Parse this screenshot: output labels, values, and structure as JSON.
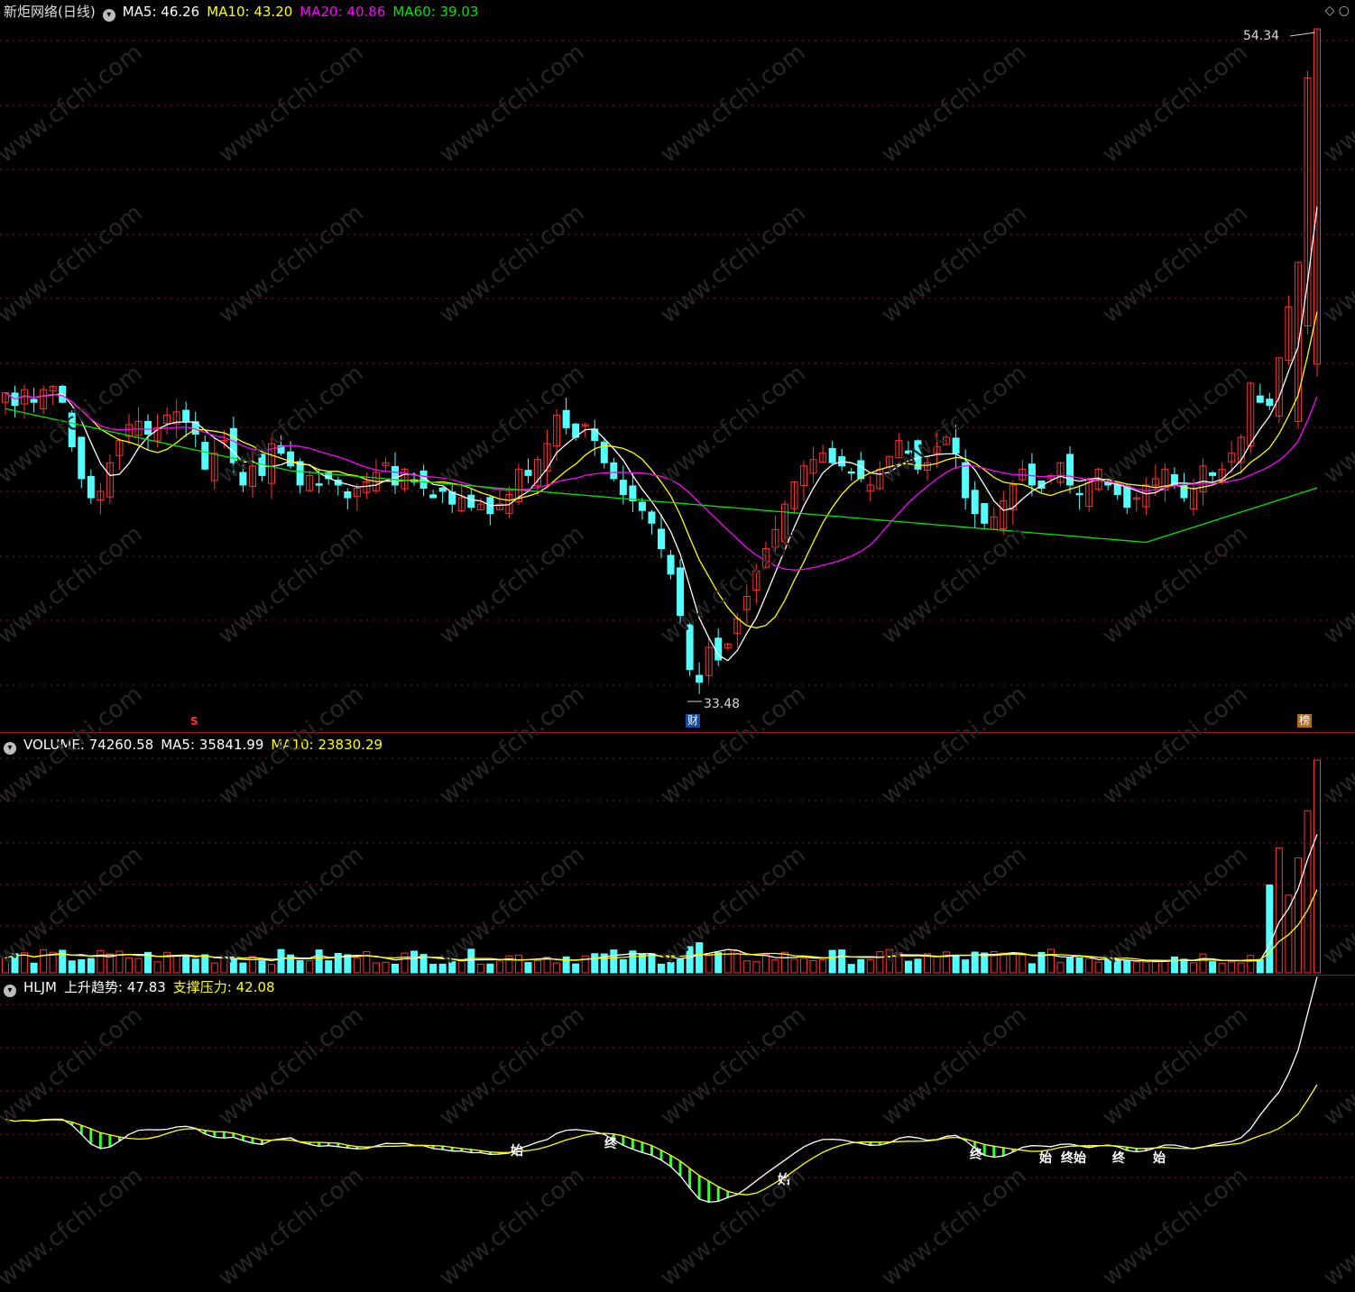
{
  "main": {
    "title": "新炬网络(日线)",
    "ma5": "MA5: 46.26",
    "ma10": "MA10: 43.20",
    "ma20": "MA20: 40.86",
    "ma60": "MA60: 39.03",
    "high_label": "54.34",
    "low_label": "33.48",
    "s_mark": "S",
    "cai_tag": "财",
    "bang_tag": "榜",
    "corner_icons": "◇ ○"
  },
  "volume": {
    "title": "VOLUME: 74260.58",
    "ma5": "MA5: 35841.99",
    "ma10": "MA10: 23830.29"
  },
  "indicator": {
    "title": "HLJM",
    "trend": "上升趋势: 47.83",
    "support": "支撑压力: 42.08",
    "markers": [
      "始",
      "终",
      "始",
      "终",
      "始",
      "终始",
      "终",
      "始"
    ]
  },
  "watermark": "www.cfchi.com",
  "colors": {
    "bg": "#000000",
    "up": "#ff3232",
    "down": "#54ffff",
    "ma5": "#ffffff",
    "ma10": "#ffff00",
    "ma20": "#ff00ff",
    "ma60": "#00e600",
    "grid": "#8b1a1a",
    "separator": "#a01818",
    "hist": "#33ff33"
  },
  "chart_data": {
    "type": "candlestick",
    "y_range_price": [
      33.48,
      54.34
    ],
    "closes": [
      42.9,
      42.5,
      43.0,
      42.6,
      43.0,
      43.1,
      42.6,
      41.2,
      40.2,
      39.6,
      39.8,
      40.7,
      41.4,
      41.9,
      42.0,
      41.6,
      41.8,
      42.2,
      42.3,
      42.0,
      41.6,
      40.5,
      41.0,
      41.4,
      40.7,
      40.0,
      40.6,
      40.3,
      41.3,
      41.0,
      40.6,
      40.0,
      40.3,
      40.0,
      40.2,
      40.0,
      39.6,
      39.9,
      40.1,
      40.4,
      40.7,
      40.0,
      40.5,
      40.1,
      39.9,
      39.6,
      39.8,
      39.4,
      39.6,
      39.3,
      39.4,
      39.1,
      39.4,
      39.7,
      40.5,
      40.3,
      40.8,
      41.3,
      42.2,
      41.8,
      41.5,
      41.9,
      41.4,
      40.7,
      40.2,
      39.7,
      39.5,
      39.2,
      38.8,
      38.0,
      37.2,
      35.9,
      34.2,
      33.8,
      34.9,
      34.5,
      35.0,
      35.8,
      36.5,
      37.3,
      38.0,
      38.6,
      39.4,
      40.1,
      40.6,
      40.8,
      41.0,
      40.7,
      40.6,
      40.4,
      40.2,
      40.0,
      40.5,
      40.9,
      41.4,
      41.0,
      40.5,
      40.7,
      41.2,
      41.5,
      41.0,
      39.6,
      39.1,
      38.8,
      39.0,
      39.5,
      40.0,
      40.5,
      40.0,
      39.9,
      40.3,
      40.7,
      40.0,
      39.7,
      40.2,
      40.5,
      40.0,
      39.7,
      39.3,
      39.6,
      40.0,
      40.2,
      40.5,
      40.0,
      39.6,
      39.9,
      40.6,
      40.3,
      40.5,
      41.0,
      41.5,
      43.2,
      42.6,
      42.5,
      44.0,
      45.6,
      47.0,
      52.8,
      54.34
    ],
    "volume_ma_note": "volume bars shown with MA5/MA10 lines"
  }
}
